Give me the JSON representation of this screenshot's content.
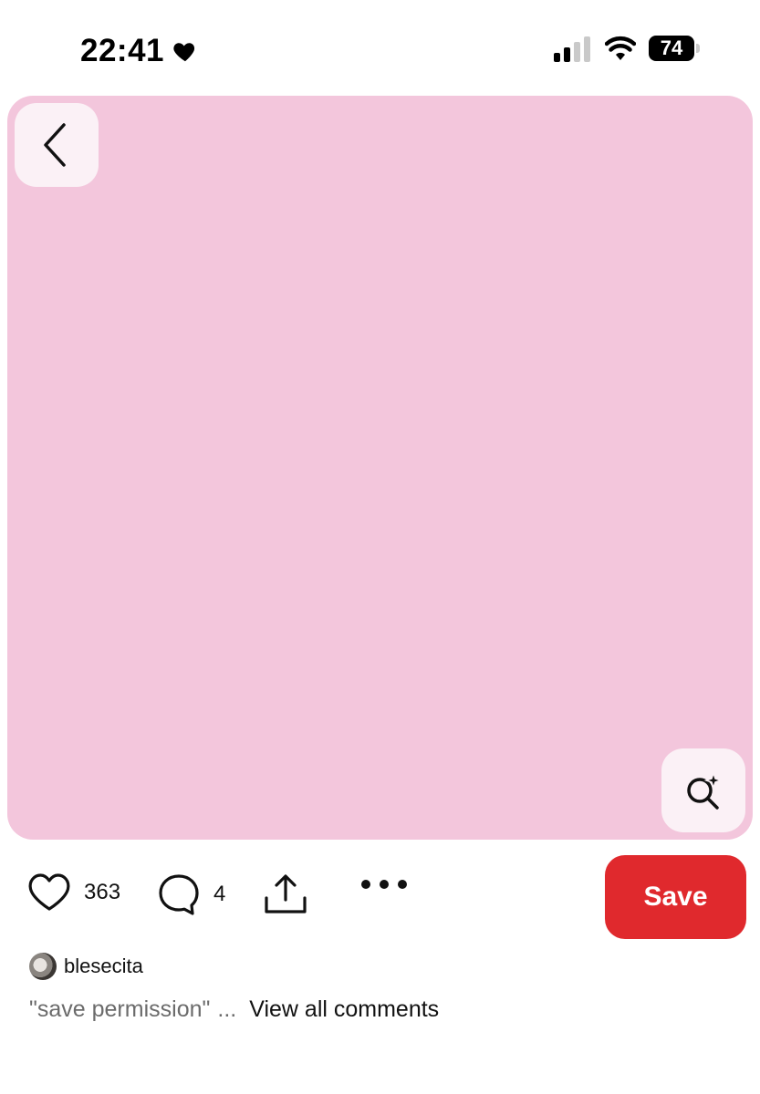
{
  "status_bar": {
    "time": "22:41",
    "battery": "74",
    "icons": [
      "heart-icon",
      "cellular-signal-icon",
      "wifi-icon",
      "battery-icon"
    ]
  },
  "pin": {
    "image_color": "#f3c6dc",
    "back_icon": "chevron-left-icon",
    "visual_search_icon": "sparkle-search-icon"
  },
  "actions": {
    "like_count": "363",
    "comment_count": "4",
    "save_label": "Save",
    "save_color": "#e0292d",
    "icons": [
      "heart-outline-icon",
      "comment-bubble-icon",
      "share-icon",
      "more-dots-icon"
    ]
  },
  "author": {
    "name": "blesecita"
  },
  "comments": {
    "snippet": "\"save permission\"",
    "ellipsis": "...",
    "view_all_label": "View all comments"
  }
}
